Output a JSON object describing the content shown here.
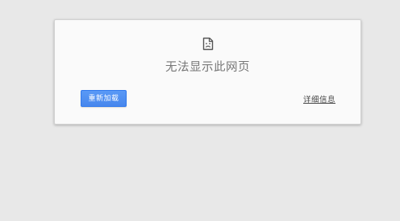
{
  "error_page": {
    "icon": "sad-document-icon",
    "title": "无法显示此网页",
    "reload_label": "重新加载",
    "details_label": "详细信息"
  },
  "colors": {
    "background": "#e8e8e8",
    "card": "#fafafa",
    "button": "#4d90fe",
    "title_text": "#767676",
    "link_text": "#444444"
  }
}
